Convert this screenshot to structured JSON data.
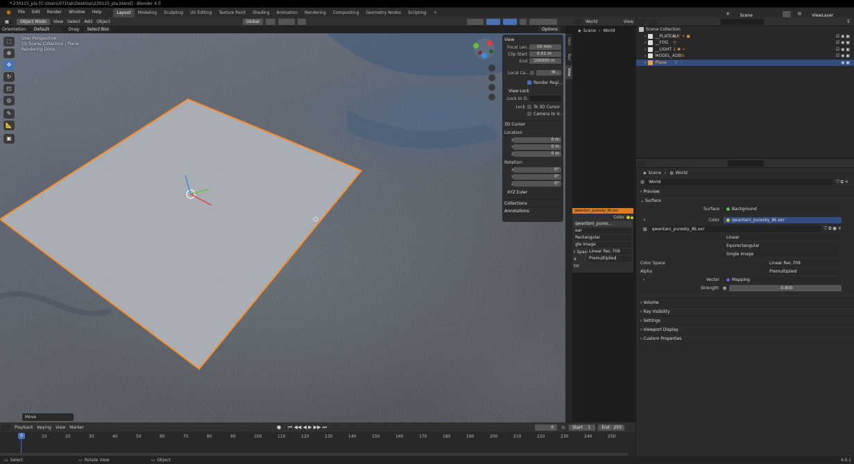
{
  "titlebar": {
    "title": "* 230115_pla [C:\\Users\\071tak\\Desktop\\230115_pla.blend] - Blender 4.0"
  },
  "menu": [
    "File",
    "Edit",
    "Render",
    "Window",
    "Help"
  ],
  "workspaces": [
    {
      "label": "Layout",
      "active": true
    },
    {
      "label": "Modeling"
    },
    {
      "label": "Sculpting"
    },
    {
      "label": "UV Editing"
    },
    {
      "label": "Texture Paint"
    },
    {
      "label": "Shading"
    },
    {
      "label": "Animation"
    },
    {
      "label": "Rendering"
    },
    {
      "label": "Compositing"
    },
    {
      "label": "Geometry Nodes"
    },
    {
      "label": "Scripting"
    },
    {
      "label": "+"
    }
  ],
  "top_right": {
    "scene": "Scene",
    "view_layer": "ViewLayer"
  },
  "viewport_header": {
    "mode": "Object Mode",
    "menus": [
      "View",
      "Select",
      "Add",
      "Object"
    ],
    "transform_orientation": "Global",
    "orientation_label": "Orientation:",
    "orientation_value": "Default",
    "drag_label": "Drag:",
    "drag_value": "Select Box",
    "options": "Options"
  },
  "viewport_overlay": {
    "line1": "User Perspective",
    "line2": "(0) Scene Collection | Plane",
    "line3": "Rendering Done"
  },
  "npanel": {
    "view_header": "View",
    "focal_label": "Focal Len...",
    "focal_value": "50 mm",
    "clip_start_label": "Clip Start",
    "clip_start_value": "0.01 m",
    "end_label": "End",
    "end_value": "100000 m",
    "local_camera_label": "Local Ca...",
    "local_camera_value": "M...",
    "render_region": "Render Regi...",
    "view_lock_header": "View Lock",
    "lock_to_label": "Lock to O...",
    "lock_label": "Lock",
    "to_3d_cursor": "To 3D Cursor",
    "camera_to_view": "Camera to V...",
    "cursor_header": "3D Cursor",
    "location_label": "Location:",
    "rotation_label": "Rotation:",
    "x": "X",
    "y": "Y",
    "z": "Z",
    "loc_x": "0 m",
    "loc_y": "0 m",
    "loc_z": "0 m",
    "rot_x": "0°",
    "rot_y": "0°",
    "rot_z": "0°",
    "euler": "XYZ Euler",
    "collections": "Collections",
    "annotations": "Annotations"
  },
  "side_tabs": [
    "Item",
    "Tool",
    "View"
  ],
  "move_panel": "Move",
  "mid_header": {
    "world": "World",
    "view": "View",
    "breadcrumb_scene": "Scene",
    "breadcrumb_world": "World"
  },
  "node": {
    "title": "qwantani_puresky_8k.exr",
    "color_label": "Color",
    "image": "qwantani_pures...",
    "rows": [
      "ear",
      "Rectangular",
      "gle Image"
    ],
    "color_space_label": "r Space",
    "color_space_value": "Linear Rec.709",
    "alpha_label": "a",
    "alpha_value": "Premultiplied",
    "vector_label": "tor"
  },
  "outliner": {
    "root": "Scene Collection",
    "items": [
      {
        "name": "__PLATEAU",
        "selected": false
      },
      {
        "name": "__FOG",
        "selected": false
      },
      {
        "name": "__LIGHT",
        "selected": false
      },
      {
        "name": "MODEL_ADD",
        "selected": false
      },
      {
        "name": "Plane",
        "selected": true
      }
    ]
  },
  "properties": {
    "breadcrumb_scene": "Scene",
    "breadcrumb_world": "World",
    "world_name": "World",
    "preview": "Preview",
    "surface_section": "Surface",
    "surface_label": "Surface",
    "surface_value": "Background",
    "color_label": "Color",
    "color_value": "qwantani_puresky_8k.exr",
    "image_name": "qwantani_puresky_8k.exr",
    "interpolation": "Linear",
    "projection": "Equirectangular",
    "source": "Single Image",
    "color_space_label": "Color Space",
    "color_space_value": "Linear Rec.709",
    "alpha_label": "Alpha",
    "alpha_value": "Premultiplied",
    "vector_label": "Vector",
    "vector_value": "Mapping",
    "strength_label": "Strength",
    "strength_value": "0.800",
    "sections": [
      "Volume",
      "Ray Visibility",
      "Settings",
      "Viewport Display",
      "Custom Properties"
    ]
  },
  "timeline": {
    "menus": [
      "Playback",
      "Keying",
      "View",
      "Marker"
    ],
    "current_frame": "0",
    "start_label": "Start",
    "start_value": "1",
    "end_label": "End",
    "end_value": "250",
    "frame_cursor": "0",
    "ticks": [
      "10",
      "20",
      "30",
      "40",
      "50",
      "60",
      "70",
      "80",
      "90",
      "100",
      "110",
      "120",
      "130",
      "140",
      "150",
      "160",
      "170",
      "180",
      "190",
      "200",
      "210",
      "220",
      "230",
      "240",
      "250"
    ]
  },
  "statusbar": {
    "select": "Select",
    "rotate": "Rotate View",
    "object": "Object",
    "version": "4.0.1"
  },
  "colors": {
    "accent": "#4772b3",
    "selection": "#ff8a1f",
    "bg": "#1d1d1d"
  }
}
